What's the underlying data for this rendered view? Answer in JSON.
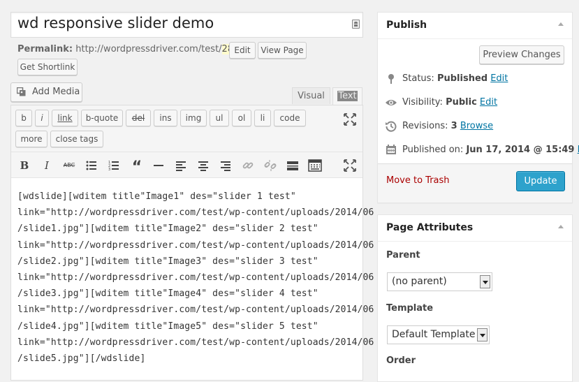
{
  "post": {
    "title": "wd responsive slider demo",
    "permalink_label": "Permalink:",
    "permalink_base": "http://wordpressdriver.com/test/",
    "permalink_slug": "28-2",
    "permalink_tail": "/",
    "edit_label": "Edit",
    "view_page_label": "View Page",
    "shortlink_label": "Get Shortlink"
  },
  "editor": {
    "add_media_label": "Add Media",
    "tab_visual": "Visual",
    "tab_text": "Text",
    "quicktags_row1": [
      "b",
      "i",
      "link",
      "b-quote",
      "del",
      "ins",
      "img",
      "ul",
      "ol",
      "li",
      "code"
    ],
    "quicktags_row2": [
      "more",
      "close tags"
    ],
    "content_lines": [
      "[wdslide][wditem title\"Image1\" des=\"slider 1 test\"",
      "link=\"http://wordpressdriver.com/test/wp-content/uploads/2014/06",
      "/slide1.jpg\"][wditem title\"Image2\" des=\"slider 2 test\"",
      "link=\"http://wordpressdriver.com/test/wp-content/uploads/2014/06",
      "/slide2.jpg\"][wditem title\"Image3\" des=\"slider 3 test\"",
      "link=\"http://wordpressdriver.com/test/wp-content/uploads/2014/06",
      "/slide3.jpg\"][wditem title\"Image4\" des=\"slider 4 test\"",
      "link=\"http://wordpressdriver.com/test/wp-content/uploads/2014/06",
      "/slide4.jpg\"][wditem title\"Image5\" des=\"slider 5 test\"",
      "link=\"http://wordpressdriver.com/test/wp-content/uploads/2014/06",
      "/slide5.jpg\"][/wdslide]"
    ]
  },
  "publish": {
    "title": "Publish",
    "preview_label": "Preview Changes",
    "status_label": "Status:",
    "status_value": "Published",
    "visibility_label": "Visibility:",
    "visibility_value": "Public",
    "revisions_label": "Revisions:",
    "revisions_value": "3",
    "browse_label": "Browse",
    "published_on_label": "Published on:",
    "published_on_value": "Jun 17, 2014 @ 15:49",
    "edit_label": "Edit",
    "trash_label": "Move to Trash",
    "update_label": "Update"
  },
  "page_attributes": {
    "title": "Page Attributes",
    "parent_label": "Parent",
    "parent_value": "(no parent)",
    "template_label": "Template",
    "template_value": "Default Template",
    "order_label": "Order"
  },
  "colors": {
    "accent": "#2ea2cc",
    "link": "#0074a2",
    "trash": "#aa0000",
    "slug_highlight": "#fffbcc"
  }
}
